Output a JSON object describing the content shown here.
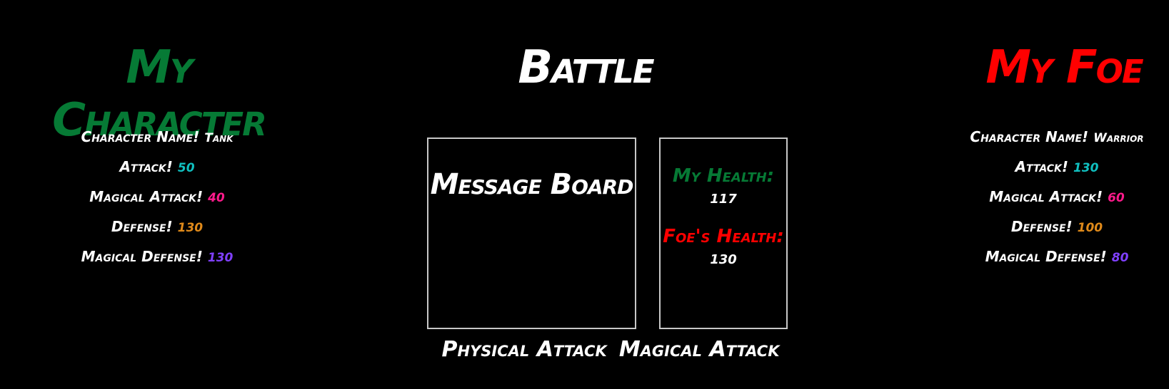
{
  "colors": {
    "my_character": "#067a35",
    "foe": "#ff0000",
    "attack": "#10c0c0",
    "magical_attack": "#ff1a8c",
    "defense": "#e08a1a",
    "magical_defense": "#8040ff"
  },
  "left": {
    "title": "My Character",
    "stats": [
      {
        "label": "Character Name!",
        "value": "Tank"
      },
      {
        "label": "Attack!",
        "value": "50"
      },
      {
        "label": "Magical Attack!",
        "value": "40"
      },
      {
        "label": "Defense!",
        "value": "130"
      },
      {
        "label": "Magical Defense!",
        "value": "130"
      }
    ]
  },
  "center": {
    "title": "Battle",
    "message_board_title": "Message Board",
    "my_health_label": "My Health:",
    "my_health_value": "117",
    "foe_health_label": "Foe's Health:",
    "foe_health_value": "130"
  },
  "right": {
    "title": "My Foe",
    "stats": [
      {
        "label": "Character Name!",
        "value": "Warrior"
      },
      {
        "label": "Attack!",
        "value": "130"
      },
      {
        "label": "Magical Attack!",
        "value": "60"
      },
      {
        "label": "Defense!",
        "value": "100"
      },
      {
        "label": "Magical Defense!",
        "value": "80"
      }
    ]
  },
  "actions": {
    "physical_attack": "Physical Attack",
    "magical_attack": "Magical Attack"
  }
}
